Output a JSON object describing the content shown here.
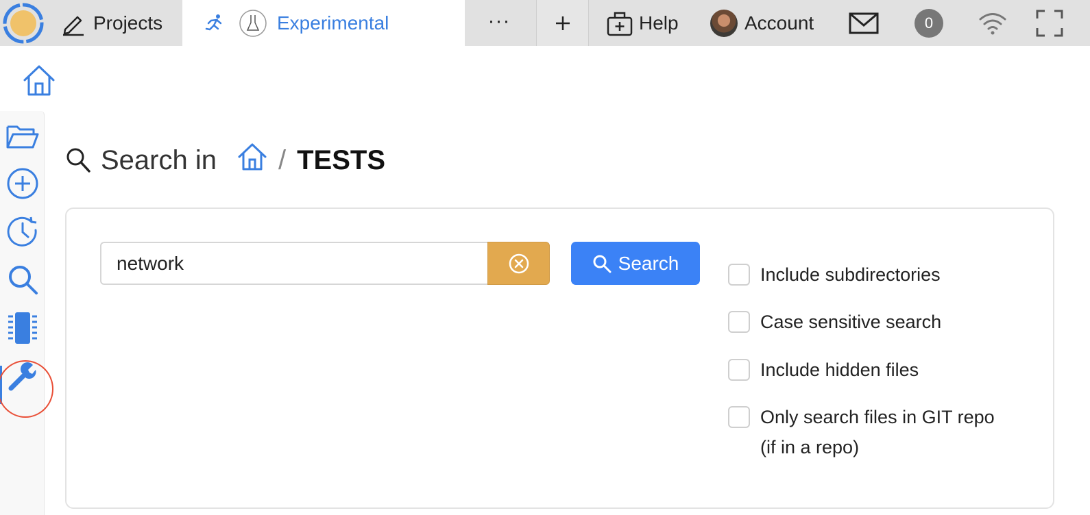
{
  "topbar": {
    "projects_label": "Projects",
    "active_tab_label": "Experimental",
    "more_label": "···",
    "help_label": "Help",
    "account_label": "Account",
    "notification_count": "0"
  },
  "heading": {
    "prefix": "Search in",
    "separator": "/",
    "folder": "TESTS"
  },
  "search": {
    "query": "network",
    "button_label": "Search"
  },
  "options": [
    {
      "label": "Include subdirectories",
      "checked": false
    },
    {
      "label": "Case sensitive search",
      "checked": false
    },
    {
      "label": "Include hidden files",
      "checked": false
    },
    {
      "label": "Only search files in GIT repo",
      "label_line2": "(if in a repo)",
      "checked": false
    }
  ],
  "sidebar": {
    "items": [
      "home-icon",
      "folder-open-icon",
      "plus-circle-icon",
      "history-icon",
      "search-icon",
      "processor-icon",
      "wrench-icon"
    ],
    "active": "search-icon"
  },
  "colors": {
    "accent": "#3a7fe0",
    "search_button": "#3b82f6",
    "clear_button": "#e2a94f",
    "highlight_circle": "#e94f37",
    "logo_fill": "#f0c26a"
  }
}
